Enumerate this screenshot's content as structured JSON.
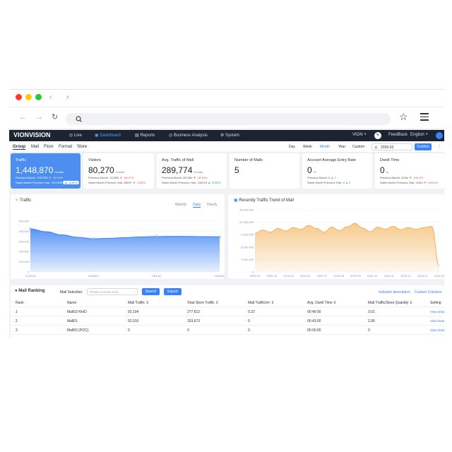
{
  "app": {
    "logo": "VIONVISION"
  },
  "nav": {
    "items": [
      "Live",
      "Dashboard",
      "Reports",
      "Business Analysis",
      "System"
    ],
    "user": "VION",
    "feedback": "FeedBack",
    "language": "English"
  },
  "toolbar": {
    "tabs": [
      "Group",
      "Mall",
      "Floor",
      "Format",
      "Store"
    ],
    "ranges": [
      "Day",
      "Week",
      "Month",
      "Year",
      "Custom"
    ],
    "date": "2026-02",
    "confirm": "Confirm"
  },
  "cards": [
    {
      "title": "Traffic",
      "value": "1,448,870",
      "unit": "Counts",
      "l1": "Previous Month:",
      "v1": "1787290",
      "c1": "-18.94%",
      "l2": "Same Month Previous Year:",
      "v2": "1221695",
      "c2": "18.60%"
    },
    {
      "title": "Visitors",
      "value": "80,270",
      "unit": "Counts",
      "l1": "Previous Month:",
      "v1": "124399",
      "c1": "-35.47%",
      "l2": "Same Month Previous Year:",
      "v2": "83297",
      "c2": "-3.63%"
    },
    {
      "title": "Avg. Traffic of Mall",
      "value": "289,774",
      "unit": "Counts",
      "l1": "Previous Month:",
      "v1": "357460",
      "c1": "-18.94%",
      "l2": "Same Month Previous Year:",
      "v2": "244219",
      "c2": "18.65%"
    },
    {
      "title": "Number of Malls",
      "value": "5",
      "unit": "",
      "l1": "",
      "v1": "",
      "c1": "",
      "l2": "",
      "v2": "",
      "c2": ""
    },
    {
      "title": "Account Average Entry Rate",
      "value": "0",
      "unit": "%",
      "l1": "Previous Month:",
      "v1": "0",
      "c1": "0",
      "l2": "Same Month Previous Year:",
      "v2": "0",
      "c2": "0"
    },
    {
      "title": "Dwell-Time",
      "value": "0",
      "unit": "m",
      "l1": "Previous Month:",
      "v1": "1h3m",
      "c1": "-100.0%",
      "l2": "Same Month Previous Year:",
      "v2": "1h4m",
      "c2": "-100.0%"
    }
  ],
  "traffic_panel": {
    "title": "Traffic",
    "tabs": [
      "Weekly",
      "Daily",
      "Hourly"
    ],
    "active": "Daily"
  },
  "trend_panel": {
    "title": "Recently Traffic Trend of Mall"
  },
  "chart_data": [
    {
      "type": "area",
      "title": "Traffic",
      "x": [
        "01(Sun)",
        "02(Mon)",
        "03(Tue)",
        "04(Wed)"
      ],
      "yticks": [
        "0",
        "100,000",
        "200,000",
        "300,000",
        "400,000",
        "500,000"
      ],
      "ylim": [
        0,
        500000
      ],
      "series": [
        {
          "values": [
            423000,
            395000,
            365000,
            340000,
            326000,
            330000,
            338000,
            344000,
            348000,
            350000,
            349000,
            347000,
            345000
          ]
        }
      ]
    },
    {
      "type": "area",
      "title": "Recently Traffic Trend of Mall",
      "x": [
        "2025-03",
        "2025-04",
        "2025-05",
        "2025-06",
        "2025-07",
        "2025-08",
        "2025-09",
        "2025-10",
        "2025-11",
        "2025-12",
        "2026-01",
        "2026-02"
      ],
      "yticks": [
        "0",
        "3,000,000",
        "6,000,000",
        "9,000,000",
        "12,000,000",
        "15,000,000"
      ],
      "ylim": [
        0,
        15000000
      ],
      "series": [
        {
          "values": [
            9300000,
            10100000,
            9600000,
            10500000,
            9900000,
            10700000,
            10300000,
            11200000,
            10500000,
            9600000,
            10800000,
            10000000,
            10900000,
            11700000,
            10600000,
            9700000,
            10800000,
            10300000,
            11000000,
            10200000,
            10700000,
            10300000,
            10700000,
            11000000,
            1500000
          ]
        }
      ]
    }
  ],
  "ranking": {
    "title": "Mall Ranking",
    "selection_label": "Mall Selection:",
    "placeholder": "Please choose store",
    "search": "Search",
    "export": "Export",
    "indicator": "Indicator description",
    "custom": "Custom Columns",
    "headers": [
      "Rank",
      "Name",
      "Mall Traffic",
      "Total Store Traffic",
      "Mall Traffic/m²",
      "Avg. Dwell Time",
      "Mall Traffic/Store Quantity",
      "Setting"
    ],
    "rows": [
      [
        "1",
        "Mall02-ReID",
        "92,194",
        "277,612",
        "0.22",
        "00:46:00",
        "3.01",
        "View Details"
      ],
      [
        "2",
        "Mall01",
        "52,010",
        "153,673",
        "0",
        "00:43:00",
        "2.95",
        "View Details"
      ],
      [
        "3",
        "Mall03 (POC)",
        "0",
        "0",
        "0",
        "00:00:00",
        "0",
        "View Details"
      ]
    ]
  }
}
